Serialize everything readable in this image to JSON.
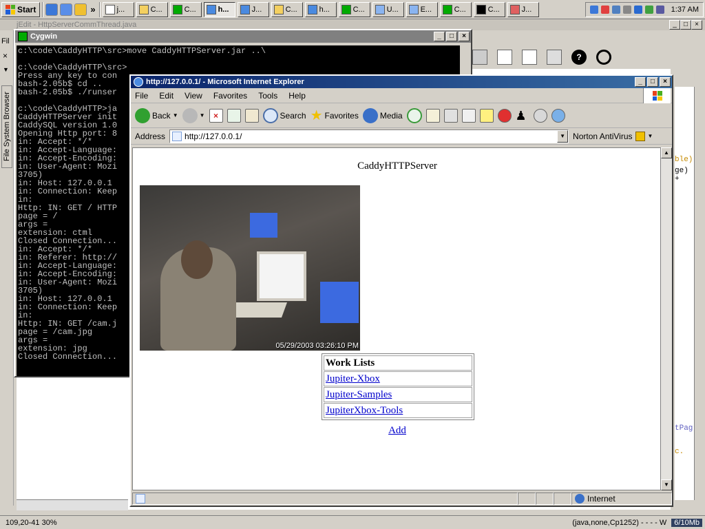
{
  "taskbar": {
    "start_label": "Start",
    "more": "»",
    "buttons": [
      {
        "label": "j..."
      },
      {
        "label": "C..."
      },
      {
        "label": "C..."
      },
      {
        "label": "h..."
      },
      {
        "label": "J..."
      },
      {
        "label": "C..."
      },
      {
        "label": "h..."
      },
      {
        "label": "C..."
      },
      {
        "label": "U..."
      },
      {
        "label": "E..."
      },
      {
        "label": "C..."
      },
      {
        "label": "C..."
      },
      {
        "label": "J..."
      }
    ],
    "clock": "1:37 AM"
  },
  "editor": {
    "title": "jEdit - HttpServerCommThread.java",
    "side_tab": "File System Browser",
    "side_menu": "Fil",
    "right_fragments": [
      "ble)",
      "ge) +",
      "tPag",
      "c."
    ],
    "status_left": "109,20-41 30%",
    "status_right": "(java,none,Cp1252) - - - - W",
    "status_mem": "6/10Mb"
  },
  "cygwin": {
    "title": "Cygwin",
    "lines": [
      "c:\\code\\CaddyHTTP\\src>move CaddyHTTPServer.jar ..\\",
      "",
      "c:\\code\\CaddyHTTP\\src>",
      "Press any key to con",
      "bash-2.05b$ cd ..",
      "bash-2.05b$ ./runser",
      "",
      "c:\\code\\CaddyHTTP>ja",
      "CaddyHTTPServer init",
      "CaddySQL version 1.0",
      "Opening Http port: 8",
      "in: Accept: */*",
      "in: Accept-Language:",
      "in: Accept-Encoding:",
      "in: User-Agent: Mozi",
      "3705)",
      "in: Host: 127.0.0.1",
      "in: Connection: Keep",
      "in:",
      "Http: IN: GET / HTTP",
      "page = /",
      "args =",
      "extension: ctml",
      "Closed Connection...",
      "in: Accept: */*",
      "in: Referer: http://",
      "in: Accept-Language:",
      "in: Accept-Encoding:",
      "in: User-Agent: Mozi",
      "3705)",
      "in: Host: 127.0.0.1",
      "in: Connection: Keep",
      "in:",
      "Http: IN: GET /cam.j",
      "page = /cam.jpg",
      "args =",
      "extension: jpg",
      "Closed Connection..."
    ]
  },
  "ie": {
    "title": "http://127.0.0.1/ - Microsoft Internet Explorer",
    "menu": [
      "File",
      "Edit",
      "View",
      "Favorites",
      "Tools",
      "Help"
    ],
    "toolbar": {
      "back": "Back",
      "search": "Search",
      "favorites": "Favorites",
      "media": "Media"
    },
    "address_label": "Address",
    "address_value": "http://127.0.0.1/",
    "norton": "Norton AntiVirus",
    "status_zone": "Internet",
    "page": {
      "heading": "CaddyHTTPServer",
      "cam_timestamp": "05/29/2003 03:26:10 PM",
      "worklist_header": "Work Lists",
      "worklists": [
        "Jupiter-Xbox",
        "Jupiter-Samples",
        "JupiterXbox-Tools"
      ],
      "add_link": "Add"
    }
  }
}
